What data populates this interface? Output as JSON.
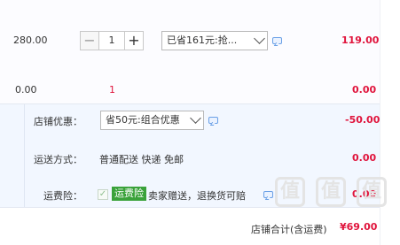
{
  "item": {
    "unit_price": "280.00",
    "quantity": "1",
    "decrement_symbol": "−",
    "increment_symbol": "+",
    "discount_option": "已省161元:抢...",
    "subtotal": "119.00"
  },
  "second_row": {
    "price": "0.00",
    "quantity": "1",
    "subtotal": "0.00"
  },
  "shop": {
    "discount_label": "店铺优惠：",
    "discount_option": "省50元:组合优惠",
    "discount_amount": "-50.00",
    "shipping_label": "运送方式：",
    "shipping_value": "普通配送 快递 免邮",
    "shipping_amount": "0.00",
    "insurance_label": "运费险：",
    "insurance_badge": "运费险",
    "insurance_text": "卖家赠送，退换货可赔",
    "insurance_amount": "0.00"
  },
  "total": {
    "label": "店铺合计(含运费)",
    "amount": "¥69.00"
  },
  "watermark": {
    "glyph": "值"
  },
  "colors": {
    "price_red": "#e0143c",
    "panel_bg": "#f2f7ff",
    "badge_green": "#3aa23a",
    "chat_blue": "#6aa0e6"
  }
}
